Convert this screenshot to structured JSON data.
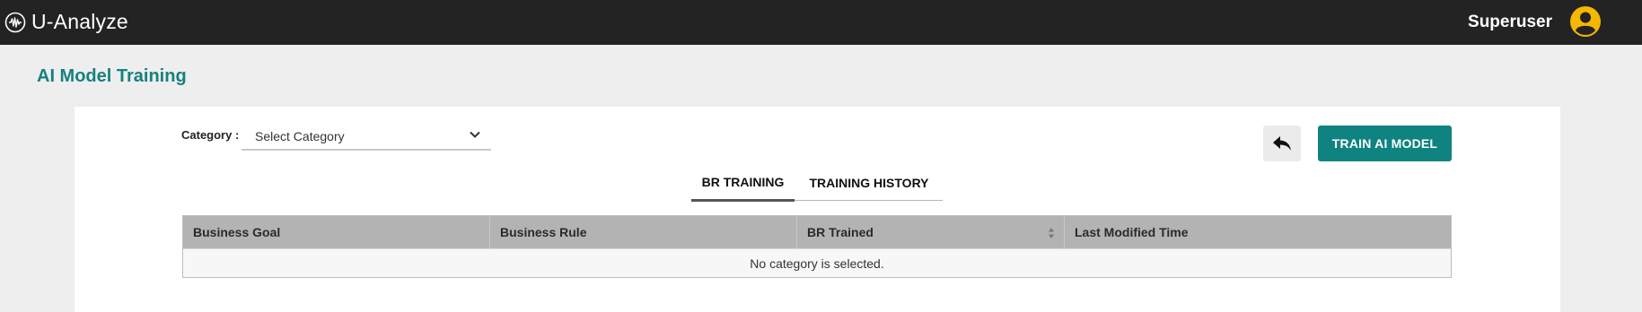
{
  "app": {
    "name": "U-Analyze",
    "brand_color": "#16817f",
    "topbar_color": "#232323",
    "avatar_color": "#f5b800"
  },
  "user": {
    "name": "Superuser",
    "icon": "user-avatar-icon"
  },
  "page": {
    "title": "AI Model Training"
  },
  "filters": {
    "category_label": "Category :",
    "category_value": "Select Category",
    "category_icon": "chevron-down-icon"
  },
  "actions": {
    "back_icon": "reply-arrow-icon",
    "train_label": "TRAIN AI MODEL"
  },
  "tabs": [
    {
      "label": "BR TRAINING",
      "active": true
    },
    {
      "label": "TRAINING HISTORY",
      "active": false
    }
  ],
  "table": {
    "columns": [
      "Business Goal",
      "Business Rule",
      "BR Trained",
      "Last Modified Time"
    ],
    "sortable_column": "BR Trained",
    "empty_message": "No category is selected."
  }
}
